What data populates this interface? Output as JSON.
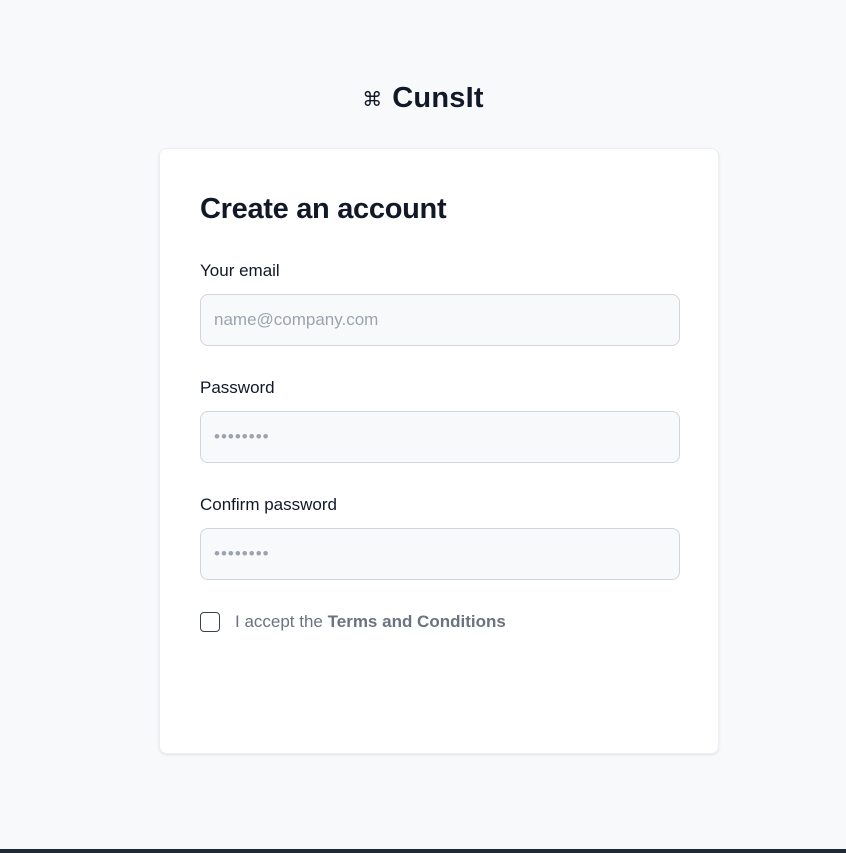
{
  "brand": {
    "icon": "⌘",
    "icon_name": "command-icon",
    "name": "CunsIt"
  },
  "form": {
    "title": "Create an account",
    "email": {
      "label": "Your email",
      "placeholder": "name@company.com",
      "value": ""
    },
    "password": {
      "label": "Password",
      "placeholder": "••••••••",
      "value": ""
    },
    "confirm_password": {
      "label": "Confirm password",
      "placeholder": "••••••••",
      "value": ""
    },
    "terms": {
      "checked": false,
      "prefix": "I accept the",
      "link_text": "Terms and Conditions"
    }
  },
  "colors": {
    "page_background": "#f8f9fb",
    "card_background": "#ffffff",
    "text_primary": "#111827",
    "text_muted": "#6b7280",
    "input_background": "#f8f9fb",
    "input_border": "#d1d5db"
  }
}
